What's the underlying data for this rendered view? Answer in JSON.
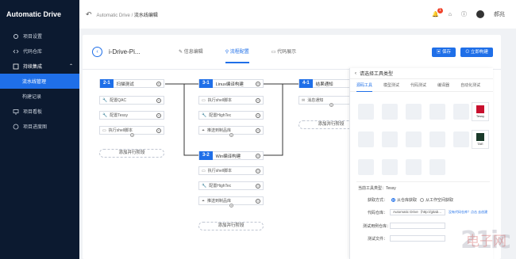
{
  "sidebar": {
    "brand": "Automatic Drive",
    "items": [
      {
        "label": "项目设置"
      },
      {
        "label": "代码仓库"
      },
      {
        "label": "持续集成"
      },
      {
        "label": "流水线管理"
      },
      {
        "label": "构建记录"
      },
      {
        "label": "项目看板"
      },
      {
        "label": "项目进度图"
      }
    ]
  },
  "topbar": {
    "crumb_root": "Automatic Drive",
    "crumb_sep": "/",
    "crumb_current": "流水线编辑",
    "notify_count": "1",
    "user_name": "郝兆"
  },
  "card": {
    "project_name": "i-Drive-Pi...",
    "tabs": [
      {
        "label": "信息编辑"
      },
      {
        "label": "流程配置"
      },
      {
        "label": "代码展示"
      }
    ],
    "save_label": "保存",
    "build_label": "立即构建"
  },
  "pipeline": {
    "stages": [
      {
        "num": "2-1",
        "name": "扫描测试",
        "tasks": [
          "配置QAC",
          "配置Tessy",
          "执行shell脚本"
        ]
      },
      {
        "num": "3-1",
        "name": "Linux编译构建",
        "tasks": [
          "执行shell脚本",
          "配置HighTec",
          "推送到制品库"
        ]
      },
      {
        "num": "3-2",
        "name": "Win编译构建",
        "tasks": [
          "执行shell脚本",
          "配置HighTec",
          "推送到制品库"
        ]
      },
      {
        "num": "4-1",
        "name": "结果通知",
        "tasks": [
          "消息通知"
        ]
      }
    ],
    "add_parallel": "添加并行阶段"
  },
  "panel": {
    "title": "请选择工具类型",
    "tabs": [
      "源码工具",
      "模型测试",
      "代码测试",
      "编译器",
      "自动化测试"
    ],
    "tools": [
      {
        "name": "Tessy"
      },
      {
        "name": "TAE"
      }
    ],
    "selected_tool_label": "当前工具类型：Tessy",
    "source_label": "获取方式：",
    "source_opt1": "从仓库获取",
    "source_opt2": "从工作空间获取",
    "repo_label": "代码仓库：",
    "repo_value": "Automatic Drive（http://gitab...",
    "repo_link": "没有代码仓库？点击",
    "repo_link2": "去创建",
    "branch_label": "测试用例仓库：",
    "more_label": "测试文件："
  },
  "watermark": {
    "text": "21ic",
    "cn": "电子网"
  },
  "colors": {
    "accent": "#1f6fe8",
    "sidebar": "#0c1a30"
  }
}
